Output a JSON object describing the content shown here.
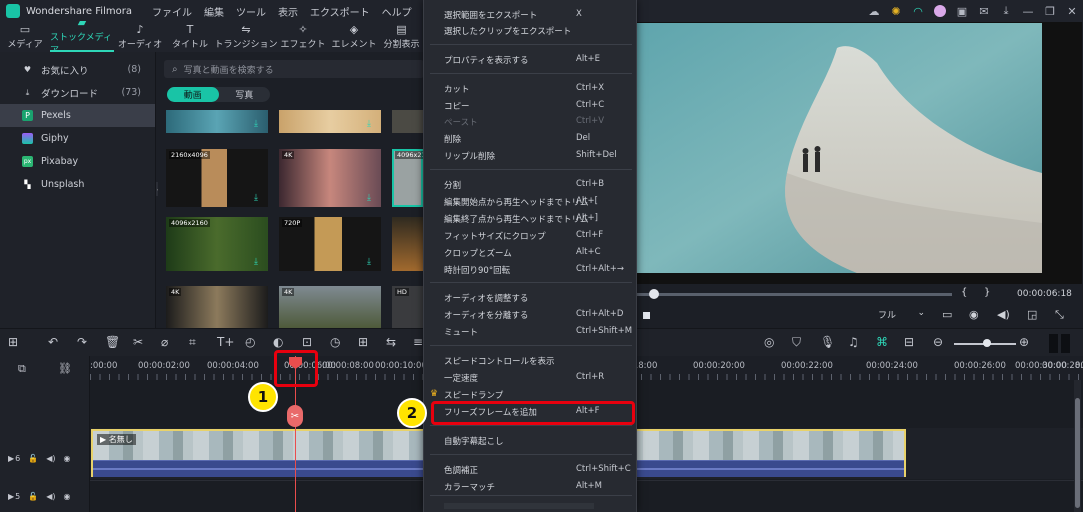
{
  "app": {
    "name": "Wondershare Filmora"
  },
  "menubar": {
    "items": [
      "ファイル",
      "編集",
      "ツール",
      "表示",
      "エクスポート",
      "ヘルプ"
    ]
  },
  "toolbar": {
    "tabs": [
      {
        "label": "メディア",
        "icon": "folder-icon"
      },
      {
        "label": "ストックメディア",
        "icon": "stock-folder-icon",
        "active": true
      },
      {
        "label": "オーディオ",
        "icon": "music-note-icon"
      },
      {
        "label": "タイトル",
        "icon": "title-t-icon"
      },
      {
        "label": "トランジション",
        "icon": "transition-icon"
      },
      {
        "label": "エフェクト",
        "icon": "effect-sparkle-icon"
      },
      {
        "label": "エレメント",
        "icon": "element-icon"
      },
      {
        "label": "分割表示",
        "icon": "split-screen-icon"
      }
    ]
  },
  "sidebar": {
    "items": [
      {
        "label": "お気に入り",
        "count": "(8)",
        "icon": "heart-icon"
      },
      {
        "label": "ダウンロード",
        "count": "(73)",
        "icon": "download-icon"
      },
      {
        "label": "Pexels",
        "count": "",
        "icon": "pexels-icon",
        "active": true
      },
      {
        "label": "Giphy",
        "count": "",
        "icon": "giphy-icon"
      },
      {
        "label": "Pixabay",
        "count": "",
        "icon": "pixabay-icon"
      },
      {
        "label": "Unsplash",
        "count": "",
        "icon": "unsplash-icon"
      }
    ]
  },
  "media": {
    "search_placeholder": "写真と動画を検索する",
    "segments": [
      "動画",
      "写真"
    ],
    "thumbnails": [
      {
        "res": ""
      },
      {
        "res": ""
      },
      {
        "res": ""
      },
      {
        "res": "2160x4096"
      },
      {
        "res": "4K"
      },
      {
        "res": "4096x2160"
      },
      {
        "res": "4096x2160"
      },
      {
        "res": "720P"
      },
      {
        "res": ""
      },
      {
        "res": "4K"
      },
      {
        "res": "4K"
      },
      {
        "res": "HD"
      }
    ]
  },
  "preview": {
    "timecode": "00:00:06:18",
    "bracket_in": "{",
    "bracket_out": "}",
    "quality": "フル"
  },
  "ruler": {
    "labels": [
      ":00:00",
      "00:00:02:00",
      "00:00:04:00",
      "00:00:06:00",
      "00:00:08:00",
      "00:00:10:00",
      "00:00:12:00",
      "00:00:14:00",
      "00:00:16:00",
      ":18:00",
      "00:00:20:00",
      "00:00:22:00",
      "00:00:24:00",
      "00:00:26:00",
      "00:00:28:00",
      "00:00:30:00",
      "00:00:32:0"
    ]
  },
  "tracks": [
    {
      "label": "6",
      "type": "video"
    },
    {
      "label": "5",
      "type": "video"
    }
  ],
  "clip": {
    "title": "名無し"
  },
  "context_menu": {
    "items": [
      {
        "label": "選択範囲をエクスポート",
        "shortcut": "X"
      },
      {
        "label": "選択したクリップをエクスポート",
        "shortcut": ""
      },
      {
        "label": "プロパティを表示する",
        "shortcut": "Alt+E"
      },
      {
        "label": "カット",
        "shortcut": "Ctrl+X"
      },
      {
        "label": "コピー",
        "shortcut": "Ctrl+C"
      },
      {
        "label": "ペースト",
        "shortcut": "Ctrl+V",
        "disabled": true
      },
      {
        "label": "削除",
        "shortcut": "Del"
      },
      {
        "label": "リップル削除",
        "shortcut": "Shift+Del"
      },
      {
        "label": "分割",
        "shortcut": "Ctrl+B"
      },
      {
        "label": "編集開始点から再生ヘッドまでトリム",
        "shortcut": "Alt+["
      },
      {
        "label": "編集終了点から再生ヘッドまでトリム",
        "shortcut": "Alt+]"
      },
      {
        "label": "フィットサイズにクロップ",
        "shortcut": "Ctrl+F"
      },
      {
        "label": "クロップとズーム",
        "shortcut": "Alt+C"
      },
      {
        "label": "時計回り90°回転",
        "shortcut": "Ctrl+Alt+→"
      },
      {
        "label": "オーディオを調整する",
        "shortcut": ""
      },
      {
        "label": "オーディオを分離する",
        "shortcut": "Ctrl+Alt+D"
      },
      {
        "label": "ミュート",
        "shortcut": "Ctrl+Shift+M"
      },
      {
        "label": "スピードコントロールを表示",
        "shortcut": ""
      },
      {
        "label": "一定速度",
        "shortcut": "Ctrl+R"
      },
      {
        "label": "スピードランプ",
        "shortcut": ""
      },
      {
        "label": "フリーズフレームを追加",
        "shortcut": "Alt+F"
      },
      {
        "label": "自動字幕起こし",
        "shortcut": ""
      },
      {
        "label": "色調補正",
        "shortcut": "Ctrl+Shift+C"
      },
      {
        "label": "カラーマッチ",
        "shortcut": "Alt+M"
      }
    ]
  },
  "annotations": {
    "badge1": "1",
    "badge2": "2",
    "highlight_color": "#e8000e"
  }
}
